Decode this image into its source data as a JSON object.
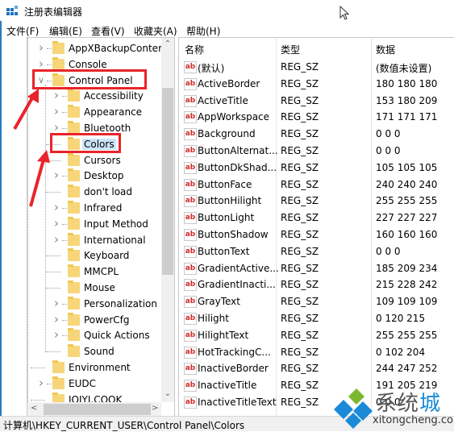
{
  "window": {
    "title": "注册表编辑器",
    "icon": "regedit-icon"
  },
  "menu": [
    {
      "label": "文件(F)"
    },
    {
      "label": "编辑(E)"
    },
    {
      "label": "查看(V)"
    },
    {
      "label": "收藏夹(A)"
    },
    {
      "label": "帮助(H)"
    }
  ],
  "tree": {
    "items": [
      {
        "label": "AppXBackupConter",
        "level": 0,
        "expander": "collapsed"
      },
      {
        "label": "Console",
        "level": 0,
        "expander": "collapsed"
      },
      {
        "label": "Control Panel",
        "level": 0,
        "expander": "expanded",
        "highlighted": true
      },
      {
        "label": "Accessibility",
        "level": 1,
        "expander": "collapsed"
      },
      {
        "label": "Appearance",
        "level": 1,
        "expander": "collapsed"
      },
      {
        "label": "Bluetooth",
        "level": 1,
        "expander": "collapsed"
      },
      {
        "label": "Colors",
        "level": 1,
        "expander": "none",
        "selected": true,
        "highlighted": true
      },
      {
        "label": "Cursors",
        "level": 1,
        "expander": "none"
      },
      {
        "label": "Desktop",
        "level": 1,
        "expander": "collapsed"
      },
      {
        "label": "don't load",
        "level": 1,
        "expander": "none"
      },
      {
        "label": "Infrared",
        "level": 1,
        "expander": "collapsed"
      },
      {
        "label": "Input Method",
        "level": 1,
        "expander": "collapsed"
      },
      {
        "label": "International",
        "level": 1,
        "expander": "collapsed"
      },
      {
        "label": "Keyboard",
        "level": 1,
        "expander": "none"
      },
      {
        "label": "MMCPL",
        "level": 1,
        "expander": "none"
      },
      {
        "label": "Mouse",
        "level": 1,
        "expander": "none"
      },
      {
        "label": "Personalization",
        "level": 1,
        "expander": "collapsed"
      },
      {
        "label": "PowerCfg",
        "level": 1,
        "expander": "collapsed"
      },
      {
        "label": "Quick Actions",
        "level": 1,
        "expander": "collapsed"
      },
      {
        "label": "Sound",
        "level": 1,
        "expander": "none"
      },
      {
        "label": "Environment",
        "level": 0,
        "expander": "none"
      },
      {
        "label": "EUDC",
        "level": 0,
        "expander": "collapsed"
      },
      {
        "label": "IQIYI.COOK",
        "level": 0,
        "expander": "none"
      }
    ]
  },
  "list": {
    "columns": [
      "名称",
      "类型",
      "数据"
    ],
    "rows": [
      {
        "name": "(默认)",
        "type": "REG_SZ",
        "data": "(数值未设置)"
      },
      {
        "name": "ActiveBorder",
        "type": "REG_SZ",
        "data": "180 180 180"
      },
      {
        "name": "ActiveTitle",
        "type": "REG_SZ",
        "data": "153 180 209"
      },
      {
        "name": "AppWorkspace",
        "type": "REG_SZ",
        "data": "171 171 171"
      },
      {
        "name": "Background",
        "type": "REG_SZ",
        "data": "0 0 0"
      },
      {
        "name": "ButtonAlternat...",
        "type": "REG_SZ",
        "data": "0 0 0"
      },
      {
        "name": "ButtonDkShad...",
        "type": "REG_SZ",
        "data": "105 105 105"
      },
      {
        "name": "ButtonFace",
        "type": "REG_SZ",
        "data": "240 240 240"
      },
      {
        "name": "ButtonHilight",
        "type": "REG_SZ",
        "data": "255 255 255"
      },
      {
        "name": "ButtonLight",
        "type": "REG_SZ",
        "data": "227 227 227"
      },
      {
        "name": "ButtonShadow",
        "type": "REG_SZ",
        "data": "160 160 160"
      },
      {
        "name": "ButtonText",
        "type": "REG_SZ",
        "data": "0 0 0"
      },
      {
        "name": "GradientActive...",
        "type": "REG_SZ",
        "data": "185 209 234"
      },
      {
        "name": "GradientInacti...",
        "type": "REG_SZ",
        "data": "215 228 242"
      },
      {
        "name": "GrayText",
        "type": "REG_SZ",
        "data": "109 109 109"
      },
      {
        "name": "Hilight",
        "type": "REG_SZ",
        "data": "0 120 215"
      },
      {
        "name": "HilightText",
        "type": "REG_SZ",
        "data": "255 255 255"
      },
      {
        "name": "HotTrackingC...",
        "type": "REG_SZ",
        "data": "0 102 204"
      },
      {
        "name": "InactiveBorder",
        "type": "REG_SZ",
        "data": "244 247 252"
      },
      {
        "name": "InactiveTitle",
        "type": "REG_SZ",
        "data": "191 205 219"
      },
      {
        "name": "InactiveTitleText",
        "type": "REG_SZ",
        "data": "0 0 0"
      }
    ]
  },
  "statusbar": {
    "path": "计算机\\HKEY_CURRENT_USER\\Control Panel\\Colors"
  },
  "watermark": {
    "brand_a": "系统",
    "brand_b": "城",
    "url": "xitongcheng.com"
  },
  "colors": {
    "annotation_red": "#e8242a",
    "selection": "#cce4f7",
    "folder": "#f7d67a",
    "title_accent": "#2b78c0"
  }
}
